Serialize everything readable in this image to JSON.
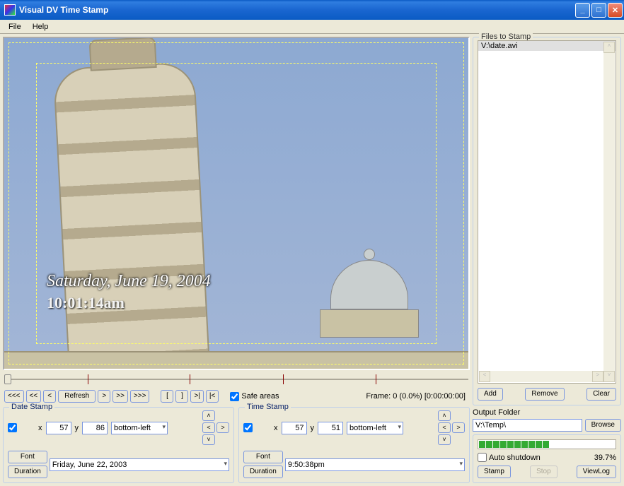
{
  "window": {
    "title": "Visual DV Time Stamp"
  },
  "menu": {
    "file": "File",
    "help": "Help"
  },
  "overlay": {
    "date": "Saturday, June 19, 2004",
    "time": "10:01:14am"
  },
  "nav": {
    "b1": "<<<",
    "b2": "<<",
    "b3": "<",
    "refresh": "Refresh",
    "b4": ">",
    "b5": ">>",
    "b6": ">>>",
    "mark_in": "[",
    "mark_out": "]",
    "go_out": ">|",
    "go_in": "|<",
    "safe_areas": "Safe areas",
    "frame_info": "Frame: 0 (0.0%) [0:00:00:00]"
  },
  "date_stamp": {
    "legend": "Date Stamp",
    "enabled": true,
    "x_label": "x",
    "x": "57",
    "y_label": "y",
    "y": "86",
    "anchor": "bottom-left",
    "font": "Font",
    "duration": "Duration",
    "value": "Friday, June 22, 2003"
  },
  "time_stamp": {
    "legend": "Time Stamp",
    "enabled": true,
    "x_label": "x",
    "x": "57",
    "y_label": "y",
    "y": "51",
    "anchor": "bottom-left",
    "font": "Font",
    "duration": "Duration",
    "value": "9:50:38pm"
  },
  "files": {
    "legend": "Files to Stamp",
    "item0": "V:\\date.avi",
    "add": "Add",
    "remove": "Remove",
    "clear": "Clear"
  },
  "output": {
    "label": "Output Folder",
    "path": "V:\\Temp\\",
    "browse": "Browse"
  },
  "bottom": {
    "auto_shutdown": "Auto shutdown",
    "percent": "39.7%",
    "stamp": "Stamp",
    "stop": "Stop",
    "viewlog": "ViewLog"
  }
}
